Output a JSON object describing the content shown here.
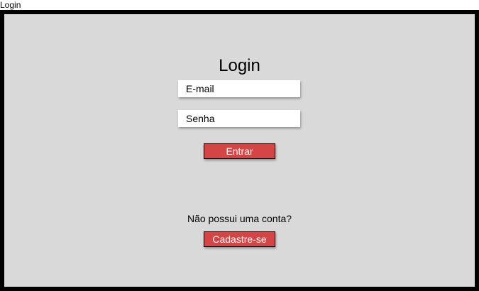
{
  "window": {
    "title": "Login"
  },
  "form": {
    "heading": "Login",
    "email_placeholder": "E-mail",
    "password_placeholder": "Senha",
    "submit_label": "Entrar"
  },
  "signup": {
    "prompt": "Não possui uma conta?",
    "button_label": "Cadastre-se"
  },
  "colors": {
    "background": "#d9d9d9",
    "frame": "#000000",
    "button": "#d64545",
    "button_text": "#ffffff"
  }
}
